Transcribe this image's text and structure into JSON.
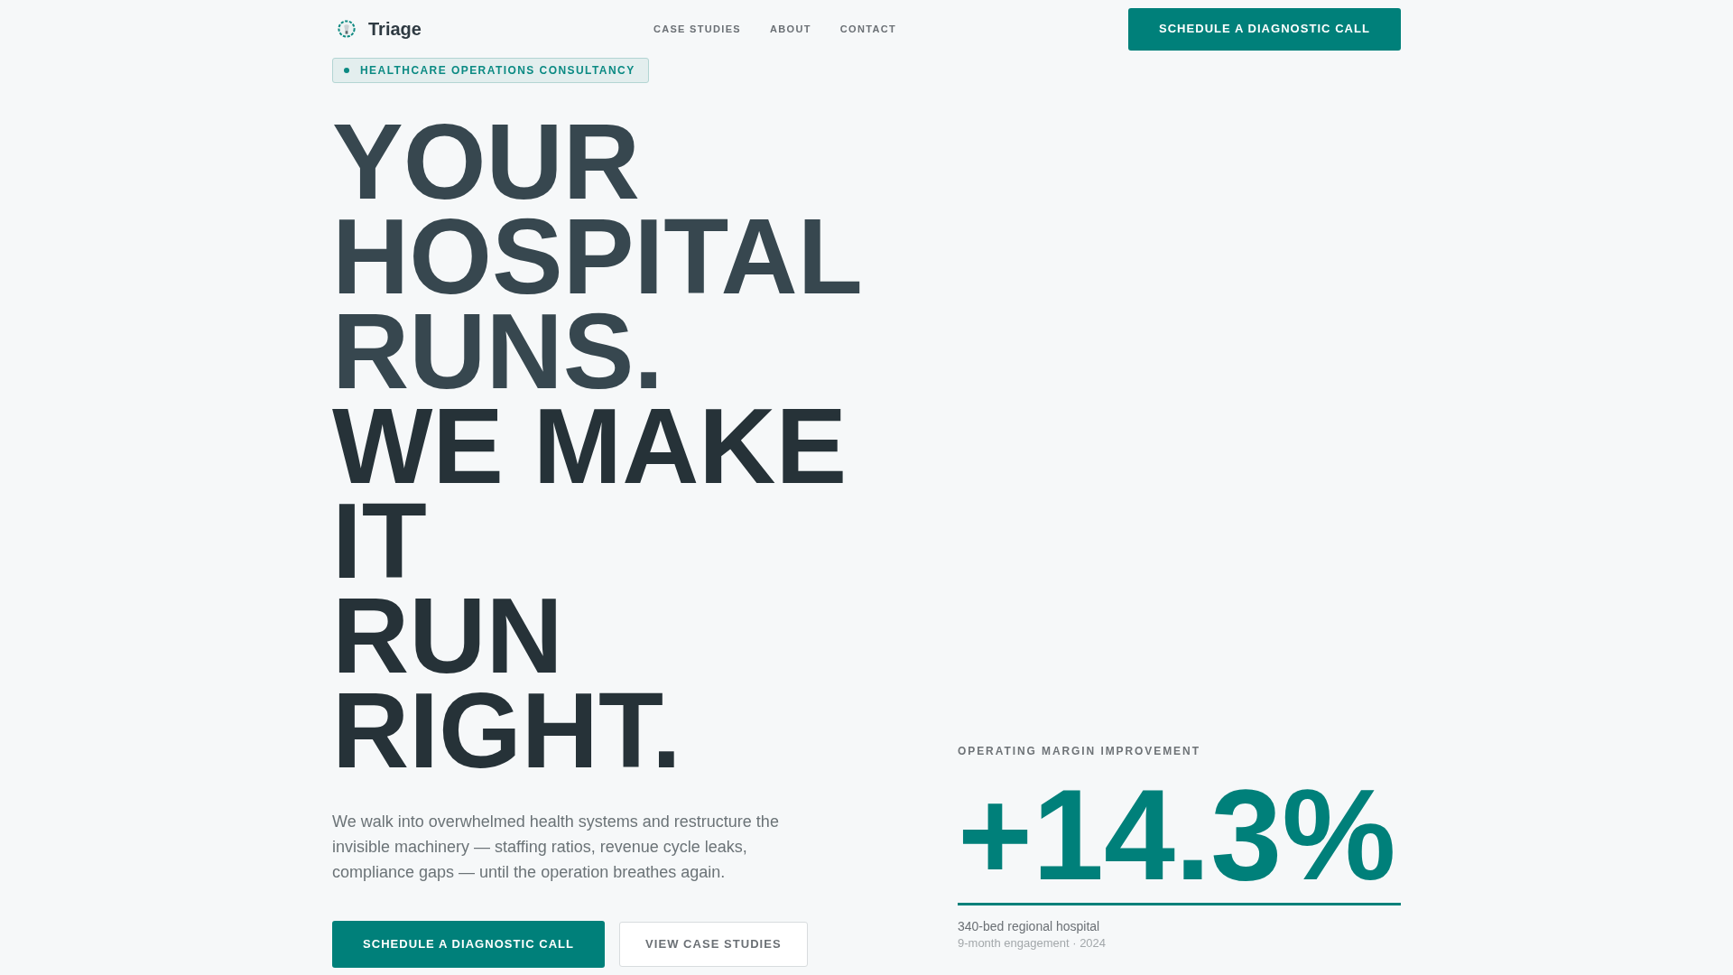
{
  "header": {
    "logo": {
      "text": "Triage"
    },
    "nav": [
      {
        "label": "CASE STUDIES"
      },
      {
        "label": "ABOUT"
      },
      {
        "label": "CONTACT"
      }
    ],
    "cta": {
      "label": "SCHEDULE A DIAGNOSTIC CALL"
    }
  },
  "hero": {
    "badge": "HEALTHCARE OPERATIONS CONSULTANCY",
    "headline": [
      {
        "lines": [
          "YOUR",
          "HOSPITAL",
          "RUNS."
        ]
      },
      {
        "lines": [
          "WE MAKE",
          "IT",
          "RUN",
          "RIGHT."
        ]
      }
    ],
    "description": "We walk into overwhelmed health systems and restructure the invisible machinery — staffing ratios, revenue cycle leaks, compliance gaps — until the operation breathes again.",
    "buttons": [
      {
        "label": "SCHEDULE A DIAGNOSTIC CALL",
        "kind": "primary"
      },
      {
        "label": "VIEW CASE STUDIES",
        "kind": "secondary"
      }
    ]
  },
  "stat": {
    "label": "OPERATING MARGIN IMPROVEMENT",
    "value": "+14.3%",
    "subject": "340-bed regional hospital",
    "detail": "9-month engagement · 2024"
  }
}
